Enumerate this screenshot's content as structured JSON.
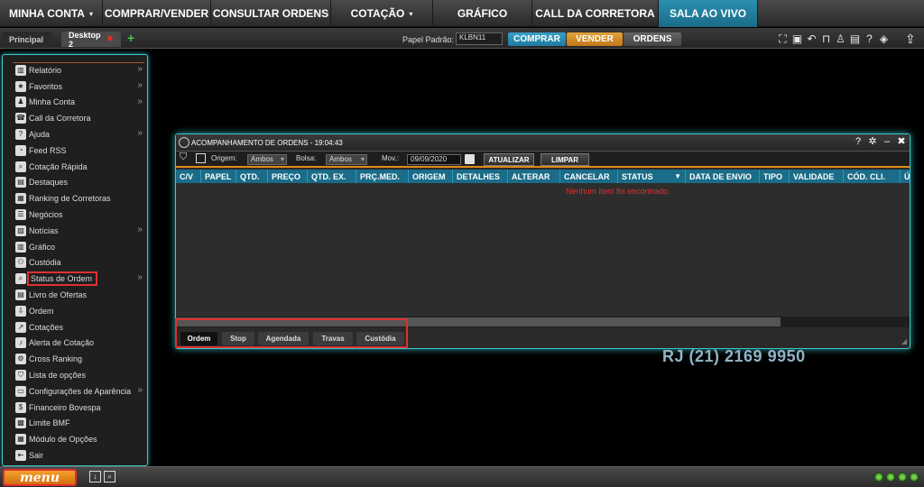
{
  "topnav": {
    "items": [
      {
        "label": "MINHA CONTA",
        "caret": "▾"
      },
      {
        "label": "COMPRAR/VENDER",
        "caret": ""
      },
      {
        "label": "CONSULTAR ORDENS",
        "caret": ""
      },
      {
        "label": "COTAÇÃO",
        "caret": "▾"
      },
      {
        "label": "GRÁFICO",
        "caret": ""
      },
      {
        "label": "CALL DA CORRETORA",
        "caret": ""
      },
      {
        "label": "SALA AO VIVO",
        "caret": ""
      }
    ],
    "active_index": 6
  },
  "subbar": {
    "tabs": [
      "Principal",
      "Desktop 2"
    ],
    "close_glyph": "✖",
    "add_glyph": "+",
    "papel_label": "Papel Padrão:",
    "papel_value": "KLBN11",
    "comprar": "COMPRAR",
    "vender": "VENDER",
    "ordens": "ORDENS"
  },
  "sidebar": {
    "items": [
      {
        "label": "Relatório",
        "icon": "bar-chart-icon",
        "arrow": true
      },
      {
        "label": "Favoritos",
        "icon": "star-icon",
        "arrow": true
      },
      {
        "label": "Minha Conta",
        "icon": "user-icon",
        "arrow": true
      },
      {
        "label": "Call da Corretora",
        "icon": "phone-icon",
        "arrow": false
      },
      {
        "label": "Ajuda",
        "icon": "help-icon",
        "arrow": true
      },
      {
        "label": "Feed RSS",
        "icon": "rss-icon",
        "arrow": false
      },
      {
        "label": "Cotação Rápida",
        "icon": "quote-icon",
        "arrow": false
      },
      {
        "label": "Destaques",
        "icon": "highlight-icon",
        "arrow": false
      },
      {
        "label": "Ranking de Corretoras",
        "icon": "ranking-icon",
        "arrow": false
      },
      {
        "label": "Negócios",
        "icon": "list-icon",
        "arrow": false
      },
      {
        "label": "Notícias",
        "icon": "news-icon",
        "arrow": true
      },
      {
        "label": "Gráfico",
        "icon": "chart-icon",
        "arrow": false
      },
      {
        "label": "Custódia",
        "icon": "custody-icon",
        "arrow": false
      },
      {
        "label": "Status de Ordem",
        "icon": "status-icon",
        "arrow": true
      },
      {
        "label": "Livro de Ofertas",
        "icon": "book-icon",
        "arrow": false
      },
      {
        "label": "Ordem",
        "icon": "order-icon",
        "arrow": false
      },
      {
        "label": "Cotações",
        "icon": "line-chart-icon",
        "arrow": false
      },
      {
        "label": "Alerta de Cotação",
        "icon": "alert-icon",
        "arrow": false
      },
      {
        "label": "Cross Ranking",
        "icon": "cross-icon",
        "arrow": false
      },
      {
        "label": "Lista de opções",
        "icon": "filter-icon",
        "arrow": false
      },
      {
        "label": "Configurações de Aparência",
        "icon": "settings-icon",
        "arrow": true
      },
      {
        "label": "Financeiro Bovespa",
        "icon": "dollar-icon",
        "arrow": false
      },
      {
        "label": "Limite BMF",
        "icon": "limit-icon",
        "arrow": false
      },
      {
        "label": "Módulo de Opções",
        "icon": "calendar-icon",
        "arrow": false
      },
      {
        "label": "Sair",
        "icon": "exit-icon",
        "arrow": false
      }
    ]
  },
  "bottombar": {
    "menu_label": "menu"
  },
  "orders": {
    "title": "ACOMPANHAMENTO DE ORDENS - 19:04:43",
    "origem_label": "Origem:",
    "origem_value": "Ambos",
    "bolsa_label": "Bolsa:",
    "bolsa_value": "Ambos",
    "mov_label": "Mov.:",
    "mov_value": "09/09/2020",
    "atualizar": "ATUALIZAR",
    "limpar": "LIMPAR",
    "columns": [
      "C/V",
      "PAPEL",
      "QTD.",
      "PREÇO",
      "QTD. EX.",
      "PRÇ.MED.",
      "ORIGEM",
      "DETALHES",
      "ALTERAR",
      "CANCELAR",
      "STATUS",
      "DATA DE ENVIO",
      "TIPO",
      "VALIDADE",
      "CÓD. CLI.",
      "Ú"
    ],
    "empty_message": "Nenhum item foi encontrado.",
    "tabs": [
      "Ordem",
      "Stop",
      "Agendada",
      "Travas",
      "Custódia"
    ]
  },
  "phone_text": "RJ (21) 2169 9950",
  "colors": {
    "accent_blue": "#1a6c88",
    "vender_orange": "#d4891e",
    "border_cyan": "#3ec7c7",
    "alert_red": "#e03030"
  }
}
